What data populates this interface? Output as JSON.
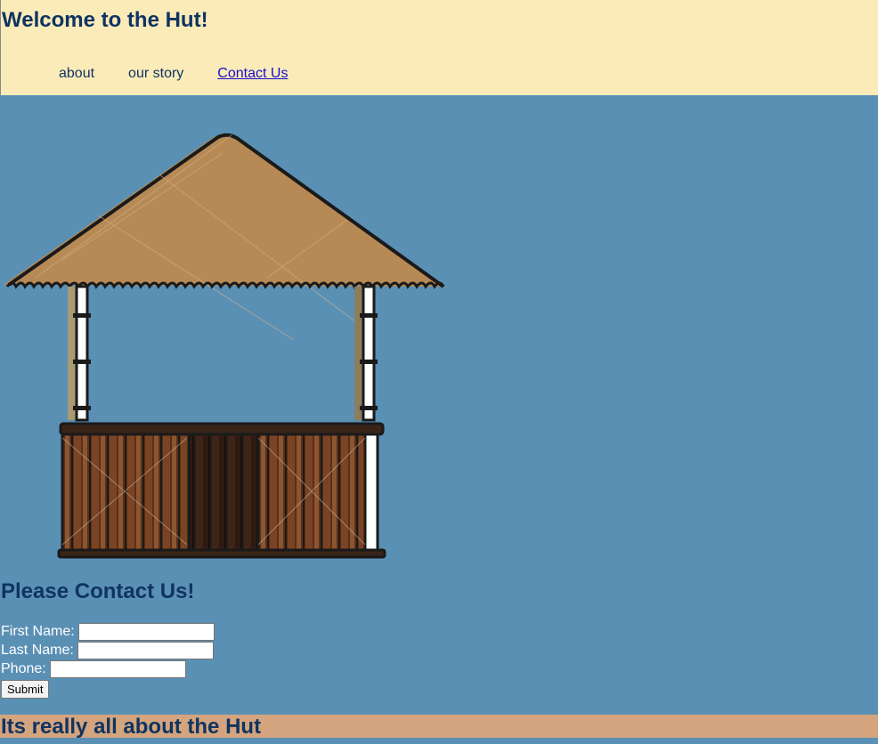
{
  "header": {
    "title": "Welcome to the Hut!",
    "nav": [
      {
        "label": "about"
      },
      {
        "label": "our story"
      },
      {
        "label": "Contact Us"
      }
    ]
  },
  "hero_image": {
    "icon": "hut-illustration"
  },
  "contact": {
    "heading": "Please Contact Us!",
    "fields": [
      {
        "label": "First Name:",
        "value": ""
      },
      {
        "label": "Last Name:",
        "value": ""
      },
      {
        "label": "Phone:",
        "value": ""
      }
    ],
    "submit_label": "Submit"
  },
  "footer": {
    "text": "Its really all about the Hut"
  },
  "colors": {
    "page_bg": "#5b90b5",
    "header_bg": "#fbebb9",
    "heading": "#0f3460",
    "footer_bg": "#d4a47e",
    "link": "#1a0dcc"
  }
}
